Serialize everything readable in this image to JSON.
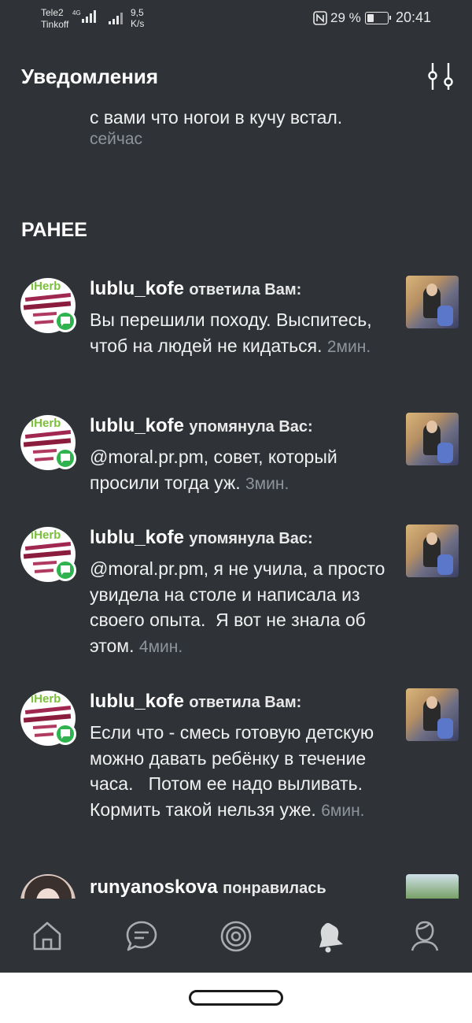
{
  "status_bar": {
    "carrier1": "Tele2",
    "carrier2": "Tinkoff",
    "network": "4G",
    "speed_value": "9,5",
    "speed_unit": "K/s",
    "battery_percent": "29 %",
    "battery_level": 0.29,
    "time": "20:41"
  },
  "header": {
    "title": "Уведомления"
  },
  "feed": {
    "partial": {
      "text": "с вами что ногои в кучу встал.",
      "time": "сейчас"
    },
    "section_title": "РАНЕЕ",
    "items": [
      {
        "avatar_brand": "iHerb",
        "user": "lublu_kofe",
        "action": "ответила Вам:",
        "text": "Вы перешили походу. Выспитесь, чтоб на людей не кидаться.",
        "time": "2мин."
      },
      {
        "avatar_brand": "iHerb",
        "user": "lublu_kofe",
        "action": "упомянула Вас:",
        "text": "@moral.pr.pm, совет, который просили тогда уж.",
        "time": "3мин."
      },
      {
        "avatar_brand": "iHerb",
        "user": "lublu_kofe",
        "action": "упомянула Вас:",
        "text": "@moral.pr.pm, я не учила, а просто увидела на столе и написала из своего опыта.  Я вот не знала об этом.",
        "time": "4мин."
      },
      {
        "avatar_brand": "iHerb",
        "user": "lublu_kofe",
        "action": "ответила Вам:",
        "text": "Если что - смесь готовую детскую можно давать ребёнку в течение часа.   Потом ее надо выливать.   Кормить такой нельзя уже.",
        "time": "6мин."
      }
    ],
    "last_item": {
      "user": "runyanoskova",
      "action": "понравилась"
    }
  },
  "tabbar": {
    "tabs": [
      "home-icon",
      "chat-icon",
      "target-icon",
      "bell-icon",
      "profile-icon"
    ],
    "active_color": "#d7d9db",
    "inactive_color": "#a9adb1"
  }
}
